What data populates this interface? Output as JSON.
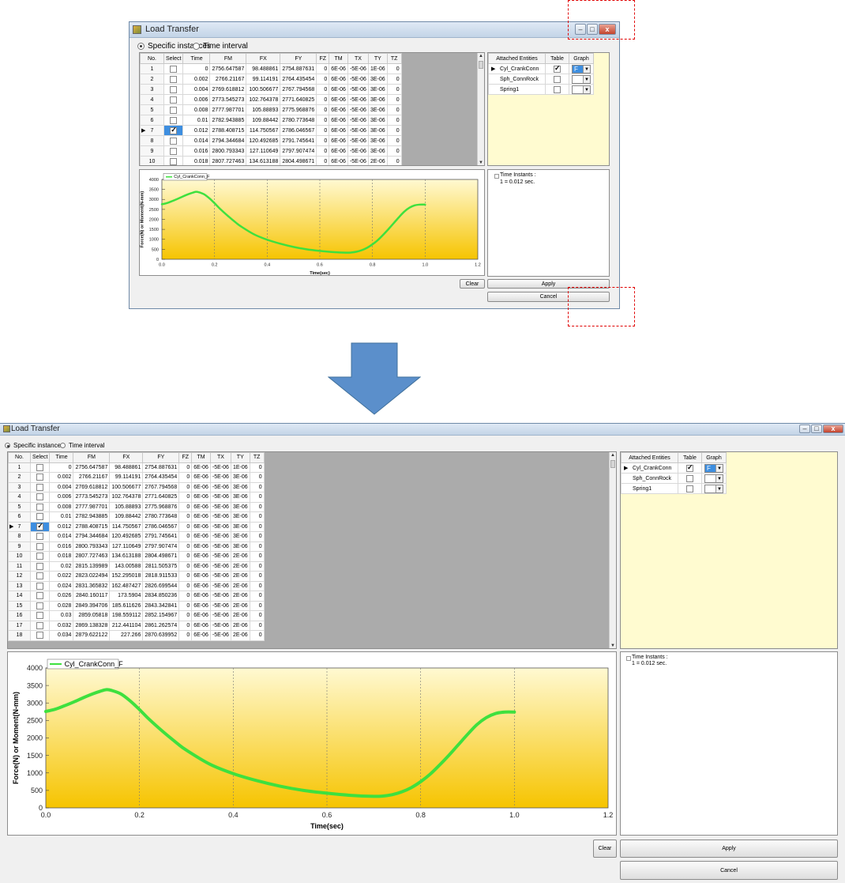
{
  "window": {
    "title": "Load Transfer",
    "minimize_glyph": "–",
    "maximize_glyph": "□",
    "close_glyph": "x"
  },
  "options": {
    "specific_instances": "Specific instances",
    "time_interval": "Time interval",
    "selected": "specific_instances"
  },
  "table": {
    "columns": [
      "No.",
      "Select",
      "Time",
      "FM",
      "FX",
      "FY",
      "FZ",
      "TM",
      "TX",
      "TY",
      "TZ"
    ],
    "selected_row": 7,
    "rows": [
      {
        "no": "1",
        "checked": false,
        "time": "0",
        "fm": "2756.647587",
        "fx": "98.488861",
        "fy": "2754.887631",
        "fz": "0",
        "tm": "6E-06",
        "tx": "-5E-06",
        "ty": "1E-06",
        "tz": "0"
      },
      {
        "no": "2",
        "checked": false,
        "time": "0.002",
        "fm": "2766.21167",
        "fx": "99.114191",
        "fy": "2764.435454",
        "fz": "0",
        "tm": "6E-06",
        "tx": "-5E-06",
        "ty": "3E-06",
        "tz": "0"
      },
      {
        "no": "3",
        "checked": false,
        "time": "0.004",
        "fm": "2769.618812",
        "fx": "100.506677",
        "fy": "2767.794568",
        "fz": "0",
        "tm": "6E-06",
        "tx": "-5E-06",
        "ty": "3E-06",
        "tz": "0"
      },
      {
        "no": "4",
        "checked": false,
        "time": "0.006",
        "fm": "2773.545273",
        "fx": "102.764378",
        "fy": "2771.640825",
        "fz": "0",
        "tm": "6E-06",
        "tx": "-5E-06",
        "ty": "3E-06",
        "tz": "0"
      },
      {
        "no": "5",
        "checked": false,
        "time": "0.008",
        "fm": "2777.987701",
        "fx": "105.88893",
        "fy": "2775.968876",
        "fz": "0",
        "tm": "6E-06",
        "tx": "-5E-06",
        "ty": "3E-06",
        "tz": "0"
      },
      {
        "no": "6",
        "checked": false,
        "time": "0.01",
        "fm": "2782.943885",
        "fx": "109.88442",
        "fy": "2780.773648",
        "fz": "0",
        "tm": "6E-06",
        "tx": "-5E-06",
        "ty": "3E-06",
        "tz": "0"
      },
      {
        "no": "7",
        "checked": true,
        "time": "0.012",
        "fm": "2788.408715",
        "fx": "114.750567",
        "fy": "2786.046567",
        "fz": "0",
        "tm": "6E-06",
        "tx": "-5E-06",
        "ty": "3E-06",
        "tz": "0"
      },
      {
        "no": "8",
        "checked": false,
        "time": "0.014",
        "fm": "2794.344684",
        "fx": "120.492685",
        "fy": "2791.745641",
        "fz": "0",
        "tm": "6E-06",
        "tx": "-5E-06",
        "ty": "3E-06",
        "tz": "0"
      },
      {
        "no": "9",
        "checked": false,
        "time": "0.016",
        "fm": "2800.793343",
        "fx": "127.110649",
        "fy": "2797.907474",
        "fz": "0",
        "tm": "6E-06",
        "tx": "-5E-06",
        "ty": "3E-06",
        "tz": "0"
      },
      {
        "no": "10",
        "checked": false,
        "time": "0.018",
        "fm": "2807.727463",
        "fx": "134.613188",
        "fy": "2804.498671",
        "fz": "0",
        "tm": "6E-06",
        "tx": "-5E-06",
        "ty": "2E-06",
        "tz": "0"
      },
      {
        "no": "11",
        "checked": false,
        "time": "0.02",
        "fm": "2815.139989",
        "fx": "143.00588",
        "fy": "2811.505375",
        "fz": "0",
        "tm": "6E-06",
        "tx": "-5E-06",
        "ty": "2E-06",
        "tz": "0"
      },
      {
        "no": "12",
        "checked": false,
        "time": "0.022",
        "fm": "2823.022494",
        "fx": "152.295018",
        "fy": "2818.911533",
        "fz": "0",
        "tm": "6E-06",
        "tx": "-5E-06",
        "ty": "2E-06",
        "tz": "0"
      },
      {
        "no": "13",
        "checked": false,
        "time": "0.024",
        "fm": "2831.365832",
        "fx": "162.487427",
        "fy": "2826.699544",
        "fz": "0",
        "tm": "6E-06",
        "tx": "-5E-06",
        "ty": "2E-06",
        "tz": "0"
      },
      {
        "no": "14",
        "checked": false,
        "time": "0.026",
        "fm": "2840.160117",
        "fx": "173.5904",
        "fy": "2834.850236",
        "fz": "0",
        "tm": "6E-06",
        "tx": "-5E-06",
        "ty": "2E-06",
        "tz": "0"
      },
      {
        "no": "15",
        "checked": false,
        "time": "0.028",
        "fm": "2849.394706",
        "fx": "185.611626",
        "fy": "2843.342841",
        "fz": "0",
        "tm": "6E-06",
        "tx": "-5E-06",
        "ty": "2E-06",
        "tz": "0"
      },
      {
        "no": "16",
        "checked": false,
        "time": "0.03",
        "fm": "2859.05818",
        "fx": "198.559112",
        "fy": "2852.154967",
        "fz": "0",
        "tm": "6E-06",
        "tx": "-5E-06",
        "ty": "2E-06",
        "tz": "0"
      },
      {
        "no": "17",
        "checked": false,
        "time": "0.032",
        "fm": "2869.138328",
        "fx": "212.441104",
        "fy": "2861.262574",
        "fz": "0",
        "tm": "6E-06",
        "tx": "-5E-06",
        "ty": "2E-06",
        "tz": "0"
      },
      {
        "no": "18",
        "checked": false,
        "time": "0.034",
        "fm": "2879.622122",
        "fx": "227.266",
        "fy": "2870.639952",
        "fz": "0",
        "tm": "6E-06",
        "tx": "-5E-06",
        "ty": "2E-06",
        "tz": "0"
      }
    ]
  },
  "entities": {
    "columns": [
      "Attached Entities",
      "Table",
      "Graph"
    ],
    "rows": [
      {
        "name": "Cyl_CrankConn",
        "table_checked": true,
        "graph_value": "F",
        "active": true
      },
      {
        "name": "Sph_ConnRock",
        "table_checked": false,
        "graph_value": "",
        "active": false
      },
      {
        "name": "Spring1",
        "table_checked": false,
        "graph_value": "",
        "active": false
      }
    ]
  },
  "time_instants": {
    "header": "Time Instants :",
    "item": "1 = 0.012 sec."
  },
  "buttons": {
    "clear": "Clear",
    "apply": "Apply",
    "cancel": "Cancel"
  },
  "colors": {
    "curve": "#3ee03e",
    "plot_top": "#fff9d2",
    "plot_bottom": "#f6c400",
    "selection": "#3d8ee0",
    "annotation": "#e00000",
    "arrow": "#5b8fcb"
  },
  "chart_data": {
    "type": "line",
    "series": [
      {
        "name": "Cyl_CrankConn_F",
        "x": [
          0,
          0.02,
          0.04,
          0.06,
          0.08,
          0.1,
          0.12,
          0.13,
          0.14,
          0.16,
          0.18,
          0.2,
          0.22,
          0.25,
          0.28,
          0.3,
          0.35,
          0.4,
          0.45,
          0.5,
          0.55,
          0.6,
          0.65,
          0.7,
          0.72,
          0.74,
          0.76,
          0.78,
          0.8,
          0.82,
          0.84,
          0.86,
          0.88,
          0.9,
          0.92,
          0.94,
          0.96,
          0.98,
          1.0
        ],
        "y": [
          2757,
          2820,
          2920,
          3030,
          3150,
          3260,
          3350,
          3380,
          3360,
          3260,
          3060,
          2810,
          2540,
          2180,
          1850,
          1650,
          1250,
          980,
          780,
          620,
          500,
          420,
          360,
          330,
          340,
          380,
          460,
          580,
          750,
          960,
          1220,
          1500,
          1800,
          2100,
          2380,
          2580,
          2700,
          2740,
          2740
        ]
      }
    ],
    "xlabel": "Time(sec)",
    "ylabel": "Force(N) or Moment(N-mm)",
    "xlim": [
      0,
      1.2
    ],
    "ylim": [
      0,
      4000
    ],
    "xticks": [
      "0.0",
      "0.2",
      "0.4",
      "0.6",
      "0.8",
      "1.0",
      "1.2"
    ],
    "yticks": [
      "0",
      "500",
      "1000",
      "1500",
      "2000",
      "2500",
      "3000",
      "3500",
      "4000"
    ],
    "grid": true,
    "legend_position": "top-left"
  }
}
